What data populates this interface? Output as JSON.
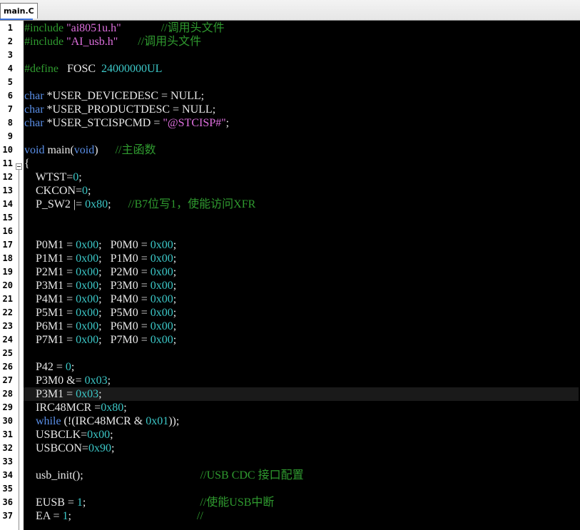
{
  "tab": {
    "label": "main.C"
  },
  "editor": {
    "current_line": 28,
    "lines": [
      {
        "n": "1",
        "tokens": [
          [
            "pp",
            "#include "
          ],
          [
            "str",
            "\"ai8051u.h\""
          ],
          [
            "plain",
            "              "
          ],
          [
            "cm",
            "//调用头文件"
          ]
        ]
      },
      {
        "n": "2",
        "tokens": [
          [
            "pp",
            "#include "
          ],
          [
            "str",
            "\"AI_usb.h\""
          ],
          [
            "plain",
            "       "
          ],
          [
            "cm",
            "//调用头文件"
          ]
        ]
      },
      {
        "n": "3",
        "tokens": []
      },
      {
        "n": "4",
        "tokens": [
          [
            "pp",
            "#define"
          ],
          [
            "plain",
            "   FOSC  "
          ],
          [
            "num",
            "24000000UL"
          ]
        ]
      },
      {
        "n": "5",
        "tokens": []
      },
      {
        "n": "6",
        "tokens": [
          [
            "kw",
            "char"
          ],
          [
            "plain",
            " *USER_DEVICEDESC = NULL;"
          ]
        ]
      },
      {
        "n": "7",
        "tokens": [
          [
            "kw",
            "char"
          ],
          [
            "plain",
            " *USER_PRODUCTDESC = NULL;"
          ]
        ]
      },
      {
        "n": "8",
        "tokens": [
          [
            "kw",
            "char"
          ],
          [
            "plain",
            " *USER_STCISPCMD = "
          ],
          [
            "str",
            "\"@STCISP#\""
          ],
          [
            "plain",
            ";"
          ]
        ]
      },
      {
        "n": "9",
        "tokens": []
      },
      {
        "n": "10",
        "tokens": [
          [
            "kw",
            "void"
          ],
          [
            "plain",
            " main("
          ],
          [
            "kw",
            "void"
          ],
          [
            "plain",
            ")      "
          ],
          [
            "cm",
            "//主函数"
          ]
        ]
      },
      {
        "n": "11",
        "tokens": [
          [
            "plain",
            "{"
          ]
        ]
      },
      {
        "n": "12",
        "tokens": [
          [
            "plain",
            "    WTST="
          ],
          [
            "num",
            "0"
          ],
          [
            "plain",
            ";"
          ]
        ]
      },
      {
        "n": "13",
        "tokens": [
          [
            "plain",
            "    CKCON="
          ],
          [
            "num",
            "0"
          ],
          [
            "plain",
            ";"
          ]
        ]
      },
      {
        "n": "14",
        "tokens": [
          [
            "plain",
            "    P_SW2 |= "
          ],
          [
            "num",
            "0x80"
          ],
          [
            "plain",
            ";      "
          ],
          [
            "cm",
            "//B7位写1，使能访问XFR"
          ]
        ]
      },
      {
        "n": "15",
        "tokens": []
      },
      {
        "n": "16",
        "tokens": []
      },
      {
        "n": "17",
        "tokens": [
          [
            "plain",
            "    P0M1 = "
          ],
          [
            "num",
            "0x00"
          ],
          [
            "plain",
            ";   P0M0 = "
          ],
          [
            "num",
            "0x00"
          ],
          [
            "plain",
            ";"
          ]
        ]
      },
      {
        "n": "18",
        "tokens": [
          [
            "plain",
            "    P1M1 = "
          ],
          [
            "num",
            "0x00"
          ],
          [
            "plain",
            ";   P1M0 = "
          ],
          [
            "num",
            "0x00"
          ],
          [
            "plain",
            ";"
          ]
        ]
      },
      {
        "n": "19",
        "tokens": [
          [
            "plain",
            "    P2M1 = "
          ],
          [
            "num",
            "0x00"
          ],
          [
            "plain",
            ";   P2M0 = "
          ],
          [
            "num",
            "0x00"
          ],
          [
            "plain",
            ";"
          ]
        ]
      },
      {
        "n": "20",
        "tokens": [
          [
            "plain",
            "    P3M1 = "
          ],
          [
            "num",
            "0x00"
          ],
          [
            "plain",
            ";   P3M0 = "
          ],
          [
            "num",
            "0x00"
          ],
          [
            "plain",
            ";"
          ]
        ]
      },
      {
        "n": "21",
        "tokens": [
          [
            "plain",
            "    P4M1 = "
          ],
          [
            "num",
            "0x00"
          ],
          [
            "plain",
            ";   P4M0 = "
          ],
          [
            "num",
            "0x00"
          ],
          [
            "plain",
            ";"
          ]
        ]
      },
      {
        "n": "22",
        "tokens": [
          [
            "plain",
            "    P5M1 = "
          ],
          [
            "num",
            "0x00"
          ],
          [
            "plain",
            ";   P5M0 = "
          ],
          [
            "num",
            "0x00"
          ],
          [
            "plain",
            ";"
          ]
        ]
      },
      {
        "n": "23",
        "tokens": [
          [
            "plain",
            "    P6M1 = "
          ],
          [
            "num",
            "0x00"
          ],
          [
            "plain",
            ";   P6M0 = "
          ],
          [
            "num",
            "0x00"
          ],
          [
            "plain",
            ";"
          ]
        ]
      },
      {
        "n": "24",
        "tokens": [
          [
            "plain",
            "    P7M1 = "
          ],
          [
            "num",
            "0x00"
          ],
          [
            "plain",
            ";   P7M0 = "
          ],
          [
            "num",
            "0x00"
          ],
          [
            "plain",
            ";"
          ]
        ]
      },
      {
        "n": "25",
        "tokens": []
      },
      {
        "n": "26",
        "tokens": [
          [
            "plain",
            "    P42 = "
          ],
          [
            "num",
            "0"
          ],
          [
            "plain",
            ";"
          ]
        ]
      },
      {
        "n": "27",
        "tokens": [
          [
            "plain",
            "    P3M0 &= "
          ],
          [
            "num",
            "0x03"
          ],
          [
            "plain",
            ";"
          ]
        ]
      },
      {
        "n": "28",
        "tokens": [
          [
            "plain",
            "    P3M1 = "
          ],
          [
            "num",
            "0x03"
          ],
          [
            "plain",
            ";"
          ]
        ]
      },
      {
        "n": "29",
        "tokens": [
          [
            "plain",
            "    IRC48MCR ="
          ],
          [
            "num",
            "0x80"
          ],
          [
            "plain",
            ";"
          ]
        ]
      },
      {
        "n": "30",
        "tokens": [
          [
            "plain",
            "    "
          ],
          [
            "kw",
            "while"
          ],
          [
            "plain",
            " (!(IRC48MCR & "
          ],
          [
            "num",
            "0x01"
          ],
          [
            "plain",
            "));"
          ]
        ]
      },
      {
        "n": "31",
        "tokens": [
          [
            "plain",
            "    USBCLK="
          ],
          [
            "num",
            "0x00"
          ],
          [
            "plain",
            ";"
          ]
        ]
      },
      {
        "n": "32",
        "tokens": [
          [
            "plain",
            "    USBCON="
          ],
          [
            "num",
            "0x90"
          ],
          [
            "plain",
            ";"
          ]
        ]
      },
      {
        "n": "33",
        "tokens": []
      },
      {
        "n": "34",
        "tokens": [
          [
            "plain",
            "    usb_init();                                         "
          ],
          [
            "cm",
            "//USB CDC 接口配置"
          ]
        ]
      },
      {
        "n": "35",
        "tokens": []
      },
      {
        "n": "36",
        "tokens": [
          [
            "plain",
            "    EUSB = "
          ],
          [
            "num",
            "1"
          ],
          [
            "plain",
            ";                                        "
          ],
          [
            "cm",
            "//使能USB中断"
          ]
        ]
      },
      {
        "n": "37",
        "tokens": [
          [
            "plain",
            "    EA = "
          ],
          [
            "num",
            "1"
          ],
          [
            "plain",
            ";                                            "
          ],
          [
            "cm",
            "//"
          ]
        ]
      }
    ]
  }
}
